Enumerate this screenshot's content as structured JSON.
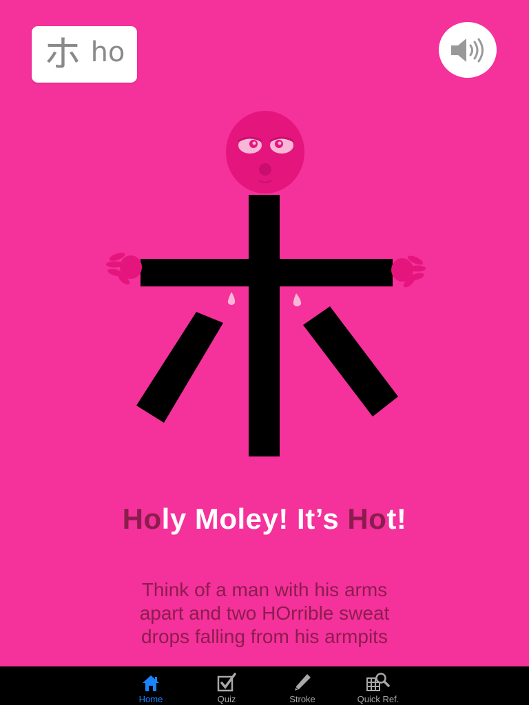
{
  "card": {
    "kana": "ホ",
    "romaji": "ho"
  },
  "sound": {
    "icon": "speaker-icon"
  },
  "mnemonic": {
    "parts": [
      {
        "text": "Ho",
        "highlight": true
      },
      {
        "text": "ly Moley! It’s ",
        "highlight": false
      },
      {
        "text": "Ho",
        "highlight": true
      },
      {
        "text": "t!",
        "highlight": false
      }
    ]
  },
  "description": {
    "lines": [
      "Think of a man with his arms",
      "apart and two HOrrible sweat",
      "drops falling from his armpits"
    ]
  },
  "tabs": [
    {
      "label": "Home",
      "icon": "home-icon",
      "active": true
    },
    {
      "label": "Quiz",
      "icon": "checkbox-icon",
      "active": false
    },
    {
      "label": "Stroke",
      "icon": "pencil-icon",
      "active": false
    },
    {
      "label": "Quick Ref.",
      "icon": "grid-search-icon",
      "active": false
    }
  ],
  "colors": {
    "background": "#f5319b",
    "accent": "#8b1d4e",
    "tab_active": "#1a84ff",
    "tab_inactive": "#a8a8a8"
  }
}
